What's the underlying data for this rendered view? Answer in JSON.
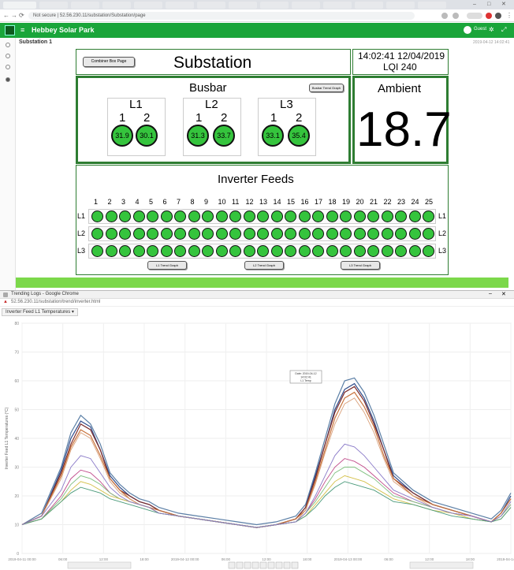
{
  "browser": {
    "url": "Not secure | 52.56.230.11/substation/Substation/page"
  },
  "app": {
    "title": "Hebbey Solar Park",
    "user": "Guest",
    "breadcrumb": "Substation 1",
    "crumb_time": "2019-04-12 14:02:41"
  },
  "dashboard": {
    "title": "Substation",
    "back_button": "Combiner Box Page",
    "time": "14:02:41 12/04/2019",
    "lqi": "LQI 240",
    "ambient_label": "Ambient",
    "ambient_value": "18.7",
    "busbar_label": "Busbar",
    "busbar_button": "Busbar Trend Graph",
    "busbar": [
      {
        "phase": "L1",
        "sensors": [
          "1",
          "2"
        ],
        "values": [
          "31.9",
          "30.1"
        ]
      },
      {
        "phase": "L2",
        "sensors": [
          "1",
          "2"
        ],
        "values": [
          "31.3",
          "33.7"
        ]
      },
      {
        "phase": "L3",
        "sensors": [
          "1",
          "2"
        ],
        "values": [
          "33.1",
          "35.4"
        ]
      }
    ],
    "inverter_label": "Inverter Feeds",
    "inverter_columns": [
      "1",
      "2",
      "3",
      "4",
      "5",
      "6",
      "7",
      "8",
      "9",
      "10",
      "11",
      "12",
      "13",
      "14",
      "15",
      "16",
      "17",
      "18",
      "19",
      "20",
      "21",
      "22",
      "23",
      "24",
      "25"
    ],
    "inverter_rows": [
      "L1",
      "L2",
      "L3"
    ],
    "inverter_buttons": [
      "L1 Trend Graph",
      "L2 Trend Graph",
      "L3 Trend Graph"
    ]
  },
  "chart_window": {
    "title": "Trending Logs - Google Chrome",
    "url": "52.56.230.11/substation/trend/inverter.html",
    "tab_label": "Inverter Feed L1 Temperatures ▾",
    "colors": [
      "#5b7fa6",
      "#2e4b8a",
      "#7a2a2a",
      "#c8733c",
      "#d9a07a",
      "#c04a8a",
      "#7fbf7f",
      "#d4c04a",
      "#4a9a7a",
      "#8a7ac8",
      "#a04040",
      "#6bb3d9",
      "#b85c8a",
      "#3a3a3a"
    ]
  },
  "chart_data": {
    "type": "line",
    "title": "",
    "xlabel": "",
    "ylabel": "Inverter Feed L1 Temperatures (°C)",
    "ylim": [
      0,
      80
    ],
    "x": [
      0,
      2,
      4,
      5,
      6,
      7,
      8,
      9,
      10,
      11,
      12,
      13,
      14,
      16,
      18,
      20,
      22,
      24,
      26,
      28,
      29,
      30,
      31,
      32,
      33,
      34,
      35,
      36,
      37,
      38,
      40,
      42,
      44,
      46,
      48,
      49,
      50
    ],
    "series": [
      {
        "values": [
          10,
          14,
          30,
          42,
          48,
          45,
          38,
          28,
          24,
          21,
          19,
          18,
          16,
          14,
          13,
          12,
          11,
          10,
          11,
          13,
          17,
          28,
          40,
          52,
          60,
          61,
          56,
          48,
          38,
          28,
          22,
          18,
          16,
          14,
          12,
          15,
          21
        ]
      },
      {
        "values": [
          10,
          13,
          29,
          40,
          46,
          44,
          36,
          27,
          23,
          20,
          18,
          17,
          15,
          13,
          12,
          11,
          10,
          9,
          10,
          12,
          16,
          27,
          38,
          50,
          57,
          59,
          54,
          46,
          36,
          27,
          21,
          17,
          15,
          13,
          11,
          14,
          20
        ]
      },
      {
        "values": [
          10,
          13,
          28,
          38,
          45,
          43,
          36,
          26,
          22,
          20,
          18,
          17,
          15,
          13,
          12,
          11,
          10,
          9,
          10,
          12,
          16,
          26,
          38,
          49,
          56,
          58,
          53,
          45,
          36,
          26,
          21,
          17,
          15,
          13,
          11,
          14,
          19
        ]
      },
      {
        "values": [
          10,
          13,
          27,
          37,
          43,
          41,
          34,
          26,
          22,
          19,
          17,
          16,
          15,
          13,
          12,
          11,
          10,
          9,
          10,
          12,
          15,
          25,
          36,
          47,
          54,
          56,
          51,
          44,
          34,
          26,
          20,
          17,
          15,
          13,
          11,
          14,
          19
        ]
      },
      {
        "values": [
          10,
          13,
          26,
          36,
          42,
          40,
          33,
          25,
          21,
          19,
          17,
          16,
          14,
          13,
          12,
          11,
          10,
          9,
          10,
          11,
          15,
          24,
          35,
          45,
          52,
          54,
          49,
          42,
          33,
          25,
          20,
          16,
          14,
          13,
          11,
          13,
          18
        ]
      },
      {
        "values": [
          10,
          12,
          20,
          26,
          29,
          28,
          25,
          21,
          19,
          18,
          17,
          16,
          14,
          13,
          12,
          11,
          10,
          9,
          10,
          11,
          14,
          19,
          25,
          30,
          33,
          32,
          30,
          27,
          24,
          21,
          18,
          16,
          14,
          13,
          11,
          13,
          17
        ]
      },
      {
        "values": [
          10,
          12,
          19,
          24,
          27,
          26,
          24,
          21,
          19,
          18,
          17,
          16,
          14,
          13,
          12,
          11,
          10,
          9,
          10,
          11,
          14,
          18,
          23,
          28,
          30,
          30,
          28,
          26,
          23,
          20,
          18,
          16,
          14,
          12,
          11,
          13,
          17
        ]
      },
      {
        "values": [
          10,
          12,
          18,
          22,
          25,
          24,
          22,
          20,
          19,
          18,
          17,
          16,
          14,
          13,
          12,
          11,
          10,
          9,
          10,
          11,
          13,
          17,
          21,
          25,
          27,
          26,
          25,
          23,
          21,
          19,
          17,
          15,
          14,
          12,
          11,
          12,
          16
        ]
      },
      {
        "values": [
          10,
          12,
          18,
          21,
          23,
          22,
          21,
          19,
          18,
          17,
          16,
          15,
          14,
          13,
          12,
          11,
          10,
          9,
          10,
          11,
          13,
          16,
          20,
          23,
          25,
          24,
          23,
          22,
          20,
          18,
          17,
          15,
          13,
          12,
          11,
          12,
          16
        ]
      },
      {
        "values": [
          10,
          13,
          22,
          30,
          34,
          33,
          28,
          23,
          20,
          18,
          17,
          16,
          14,
          13,
          12,
          11,
          10,
          9,
          10,
          11,
          14,
          20,
          27,
          34,
          38,
          37,
          34,
          30,
          26,
          22,
          19,
          16,
          14,
          13,
          11,
          13,
          18
        ]
      }
    ],
    "x_ticks": [
      "2019-04-11 00:00",
      "06:00",
      "12:00",
      "18:00",
      "2019-04-12 00:00",
      "06:00",
      "12:00",
      "18:00",
      "2019-04-13 00:00",
      "06:00",
      "12:00",
      "18:00",
      "2019-04-14 00:00"
    ],
    "y_ticks": [
      "0",
      "10",
      "20",
      "30",
      "40",
      "50",
      "60",
      "70",
      "80"
    ],
    "tooltip": [
      "Date: 2019-04-12",
      "14:02:41",
      "L1 Temp"
    ],
    "grid": true
  }
}
